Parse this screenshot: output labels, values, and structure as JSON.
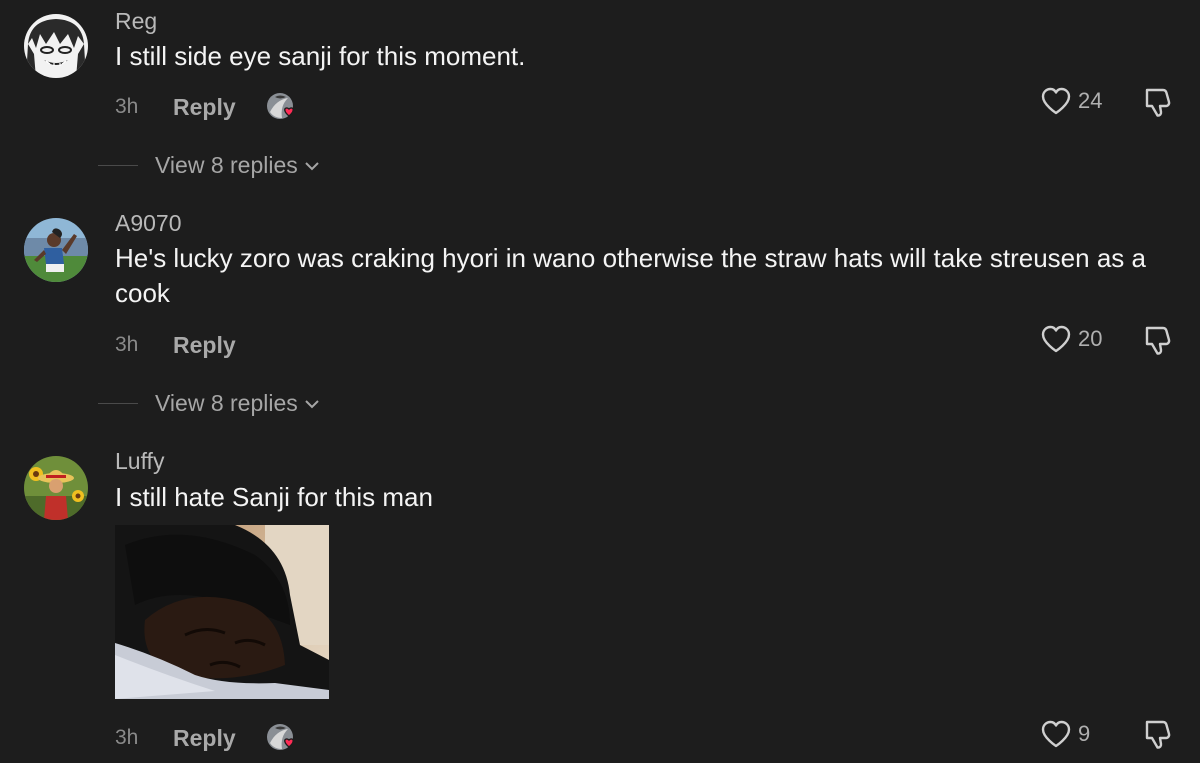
{
  "comments": [
    {
      "username": "Reg",
      "text": "I still side eye sanji for this moment.",
      "time": "3h",
      "reply_label": "Reply",
      "likes": "24",
      "creator_liked": true,
      "view_replies": "View 8 replies",
      "avatar_icon": "manga-face-avatar"
    },
    {
      "username": "A9070",
      "text": "He's lucky zoro was craking hyori in wano otherwise the straw hats will take streusen as a cook",
      "time": "3h",
      "reply_label": "Reply",
      "likes": "20",
      "creator_liked": false,
      "view_replies": "View 8 replies",
      "avatar_icon": "football-player-avatar"
    },
    {
      "username": "Luffy",
      "text": "I still hate Sanji for this man",
      "time": "3h",
      "reply_label": "Reply",
      "likes": "9",
      "creator_liked": true,
      "has_image": true,
      "avatar_icon": "straw-hat-sunflower-avatar"
    }
  ],
  "colors": {
    "background": "#1d1d1d",
    "username": "#b9b9b9",
    "text": "#f4f4f4",
    "muted": "#8a8a8a",
    "heart_badge": "#fe2c55"
  },
  "icons": {
    "like": "heart-outline-icon",
    "dislike": "thumbs-down-icon",
    "expand": "chevron-down-icon",
    "creator_like": "creator-liked-badge"
  }
}
